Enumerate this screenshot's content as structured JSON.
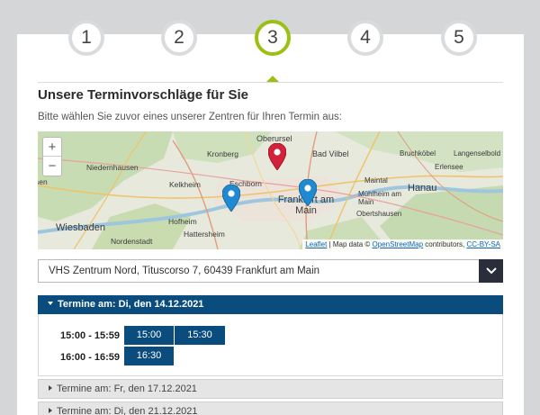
{
  "steps": [
    {
      "label": "1",
      "active": false
    },
    {
      "label": "2",
      "active": false
    },
    {
      "label": "3",
      "active": true
    },
    {
      "label": "4",
      "active": false
    },
    {
      "label": "5",
      "active": false
    }
  ],
  "heading": "Unsere Terminvorschläge für Sie",
  "intro": "Bitte wählen Sie zuvor eines unserer Zentren für Ihren Termin aus:",
  "map": {
    "places": {
      "oberursel": "Oberursel",
      "kronberg": "Kronberg",
      "bad_vilbel": "Bad Vilbel",
      "bruchkoebel": "Bruchköbel",
      "langenselbold": "Langenselbold",
      "niedernhausen": "Niedernhausen",
      "kelkheim": "Kelkheim",
      "eschborn": "Eschborn",
      "maintal": "Maintal",
      "erlensee": "Erlensee",
      "hanau": "Hanau",
      "frankfurt": "Frankfurt am Main",
      "muehlheim": "Mühlheim am Main",
      "obertshausen": "Obertshausen",
      "hofheim": "Hofheim",
      "hattersheim": "Hattersheim",
      "wiesbaden": "Wiesbaden",
      "nordenstadt": "Nordenstadt",
      "fragment_left": "sen"
    },
    "zoom_in": "+",
    "zoom_out": "−",
    "attribution": {
      "leaflet": "Leaflet",
      "sep": " | Map data © ",
      "osm": "OpenStreetMap",
      "contributors": " contributors, ",
      "license": "CC-BY-SA"
    },
    "colors": {
      "pin_selected": "#d3213b",
      "pin_other": "#1f8ad1"
    }
  },
  "center_select": {
    "value": "VHS Zentrum Nord, Tituscorso 7, 60439 Frankfurt am Main"
  },
  "appointments": {
    "open": {
      "title": "Termine am: Di, den 14.12.2021",
      "rows": [
        {
          "range": "15:00 - 15:59",
          "slots": [
            "15:00",
            "15:30"
          ]
        },
        {
          "range": "16:00 - 16:59",
          "slots": [
            "16:30"
          ]
        }
      ]
    },
    "closed": [
      {
        "title": "Termine am: Fr, den 17.12.2021"
      },
      {
        "title": "Termine am: Di, den 21.12.2021"
      }
    ]
  },
  "colors": {
    "accent": "#9bbf13",
    "primary": "#0b4c7e",
    "dark": "#2a2d3a"
  }
}
